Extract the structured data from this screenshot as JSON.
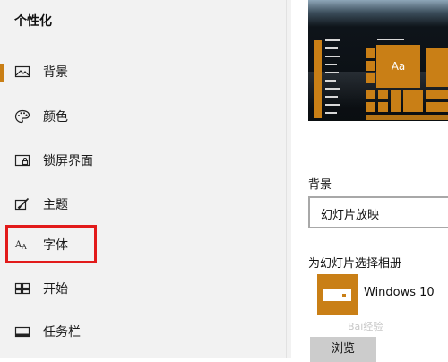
{
  "sidebar": {
    "title": "个性化",
    "items": [
      {
        "label": "背景",
        "icon": "picture-icon",
        "selected": true
      },
      {
        "label": "颜色",
        "icon": "palette-icon",
        "selected": false
      },
      {
        "label": "锁屏界面",
        "icon": "lock-screen-icon",
        "selected": false
      },
      {
        "label": "主题",
        "icon": "theme-brush-icon",
        "selected": false
      },
      {
        "label": "字体",
        "icon": "font-icon",
        "selected": false
      },
      {
        "label": "开始",
        "icon": "start-grid-icon",
        "selected": false
      },
      {
        "label": "任务栏",
        "icon": "taskbar-icon",
        "selected": false
      }
    ]
  },
  "preview": {
    "tile_text": "Aa"
  },
  "background_section": {
    "label": "背景",
    "dropdown_value": "幻灯片放映"
  },
  "album_section": {
    "label": "为幻灯片选择相册",
    "album_name": "Windows 10",
    "browse_label": "浏览"
  },
  "watermark": {
    "text": "Bai经验"
  },
  "colors": {
    "accent": "#c97f16",
    "highlight": "#e21b1b",
    "sidebar_bg": "#f2f2f2"
  }
}
